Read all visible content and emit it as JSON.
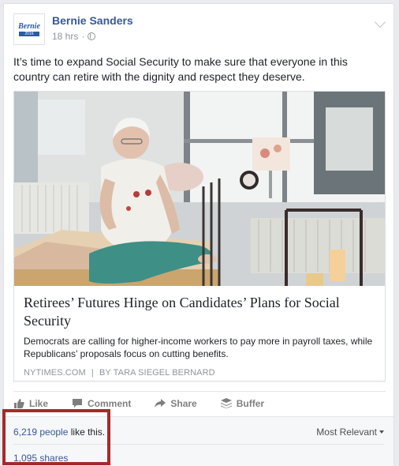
{
  "post": {
    "author": "Bernie Sanders",
    "timestamp": "18 hrs",
    "avatar_text": "Bernie",
    "avatar_sub": "2016",
    "text": "It’s time to expand Social Security to make sure that everyone in this country can retire with the dignity and respect they deserve."
  },
  "link": {
    "title": "Retirees’ Futures Hinge on Candidates’ Plans for Social Security",
    "description": "Democrats are calling for higher-income workers to pay more in payroll taxes, while Republicans’ proposals focus on cutting benefits.",
    "source": "NYTIMES.COM",
    "separator": "|",
    "byline": "BY TARA SIEGEL BERNARD"
  },
  "actions": {
    "like": "Like",
    "comment": "Comment",
    "share": "Share",
    "buffer": "Buffer"
  },
  "summary": {
    "likes_count": "6,219 people",
    "likes_suffix": " like this.",
    "sort_label": "Most Relevant",
    "shares": "1,095 shares"
  },
  "colors": {
    "link_blue": "#365899",
    "highlight": "#a52a2a"
  }
}
